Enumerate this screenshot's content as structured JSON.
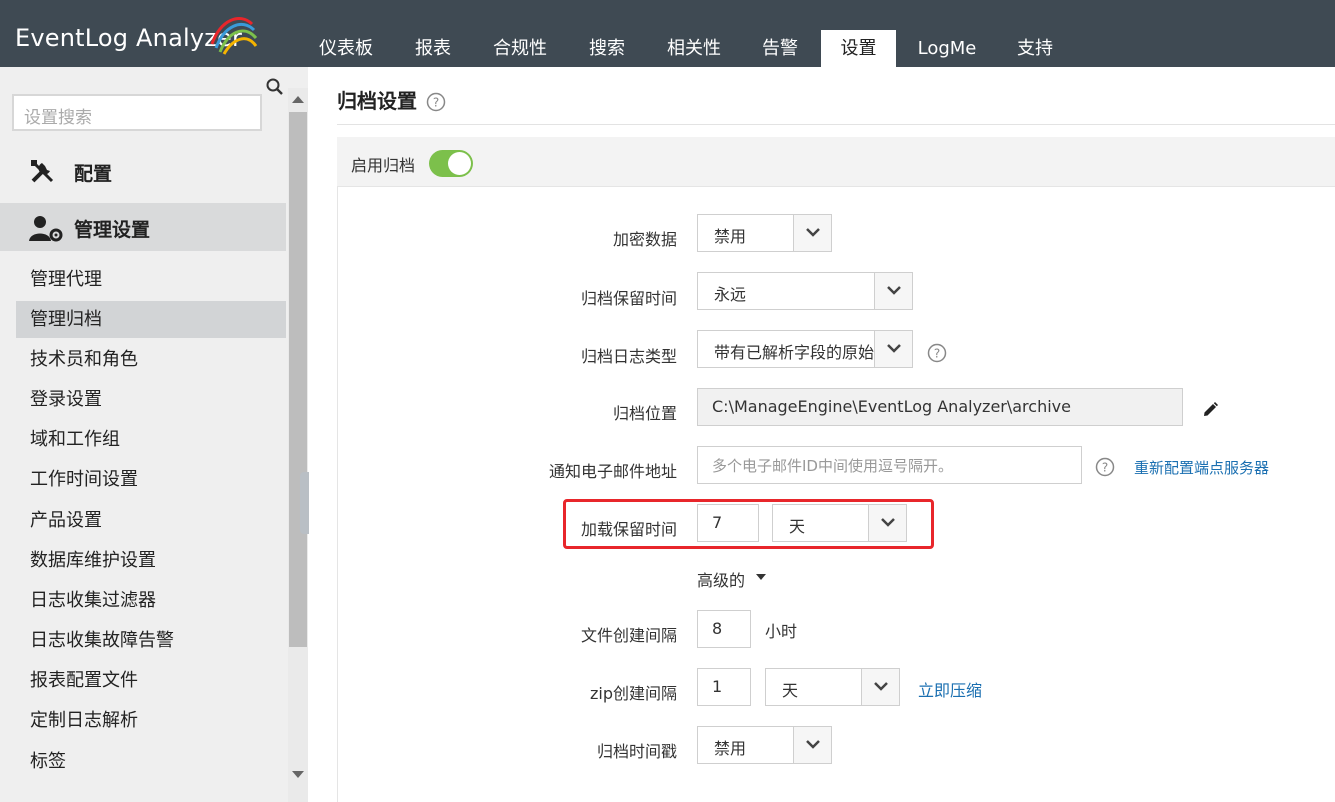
{
  "app": {
    "logo_text": "EventLog Analyzer"
  },
  "nav": {
    "tabs": [
      "仪表板",
      "报表",
      "合规性",
      "搜索",
      "相关性",
      "告警",
      "设置",
      "LogMe",
      "支持"
    ],
    "active": "设置"
  },
  "sidebar": {
    "search_placeholder": "设置搜索",
    "section_config": "配置",
    "section_admin": "管理设置",
    "items": [
      "管理代理",
      "管理归档",
      "技术员和角色",
      "登录设置",
      "域和工作组",
      "工作时间设置",
      "产品设置",
      "数据库维护设置",
      "日志收集过滤器",
      "日志收集故障告警",
      "报表配置文件",
      "定制日志解析",
      "标签"
    ],
    "active_item": "管理归档"
  },
  "page": {
    "title": "归档设置",
    "enable_archive_label": "启用归档",
    "enable_archive_on": true
  },
  "form": {
    "encrypt": {
      "label": "加密数据",
      "value": "禁用"
    },
    "retention": {
      "label": "归档保留时间",
      "value": "永远"
    },
    "log_type": {
      "label": "归档日志类型",
      "value": "带有已解析字段的原始"
    },
    "location": {
      "label": "归档位置",
      "value": "C:\\ManageEngine\\EventLog Analyzer\\archive"
    },
    "email": {
      "label": "通知电子邮件地址",
      "placeholder": "多个电子邮件ID中间使用逗号隔开。",
      "link": "重新配置端点服务器"
    },
    "load_retention": {
      "label": "加载保留时间",
      "value": "7",
      "unit": "天"
    },
    "advanced": {
      "label": "高级的"
    },
    "file_interval": {
      "label": "文件创建间隔",
      "value": "8",
      "unit": "小时"
    },
    "zip_interval": {
      "label": "zip创建间隔",
      "value": "1",
      "unit": "天",
      "link": "立即压缩"
    },
    "timestamp": {
      "label": "归档时间戳",
      "value": "禁用"
    }
  },
  "colors": {
    "topbar": "#3f4a53",
    "toggle_on": "#7cc04b",
    "link": "#1a6fb1",
    "highlight": "#e8262b"
  }
}
